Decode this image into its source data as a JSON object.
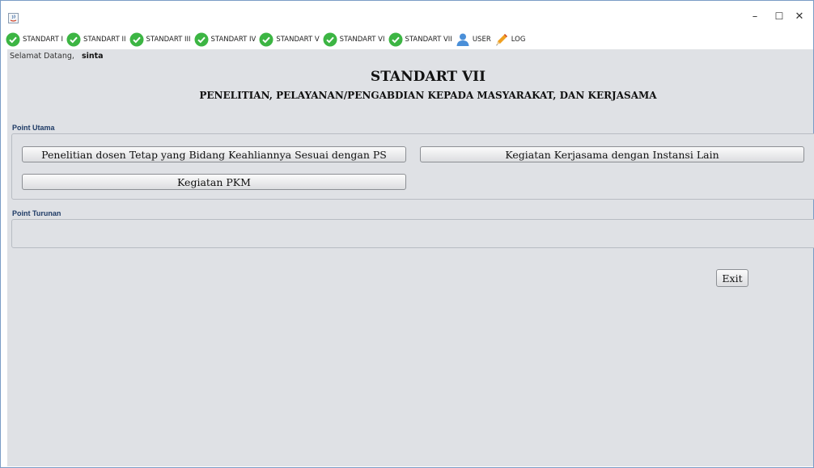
{
  "window": {
    "controls": {
      "minimize": "–",
      "maximize": "☐",
      "close": "✕"
    }
  },
  "menu": {
    "items": [
      {
        "label": "STANDART I",
        "icon": "check-circle-icon"
      },
      {
        "label": "STANDART II",
        "icon": "check-circle-icon"
      },
      {
        "label": "STANDART III",
        "icon": "check-circle-icon"
      },
      {
        "label": "STANDART IV",
        "icon": "check-circle-icon"
      },
      {
        "label": "STANDART V",
        "icon": "check-circle-icon"
      },
      {
        "label": "STANDART VI",
        "icon": "check-circle-icon"
      },
      {
        "label": "STANDART VII",
        "icon": "check-circle-icon"
      },
      {
        "label": "USER",
        "icon": "user-icon"
      },
      {
        "label": "LOG",
        "icon": "pencil-icon"
      }
    ]
  },
  "welcome": {
    "prefix": "Selamat Datang,",
    "username": "sinta"
  },
  "header": {
    "title": "STANDART VII",
    "subtitle": "PENELITIAN, PELAYANAN/PENGABDIAN KEPADA MASYARAKAT, DAN KERJASAMA"
  },
  "point_utama": {
    "label": "Point Utama",
    "buttons": {
      "penelitian": "Penelitian dosen Tetap yang Bidang Keahliannya Sesuai dengan PS",
      "kerjasama": "Kegiatan Kerjasama dengan Instansi Lain",
      "pkm": "Kegiatan PKM"
    }
  },
  "point_turunan": {
    "label": "Point Turunan"
  },
  "exit_label": "Exit",
  "colors": {
    "check_green": "#3cb543",
    "user_blue": "#4a8fd8",
    "pencil_orange": "#f0a020"
  }
}
